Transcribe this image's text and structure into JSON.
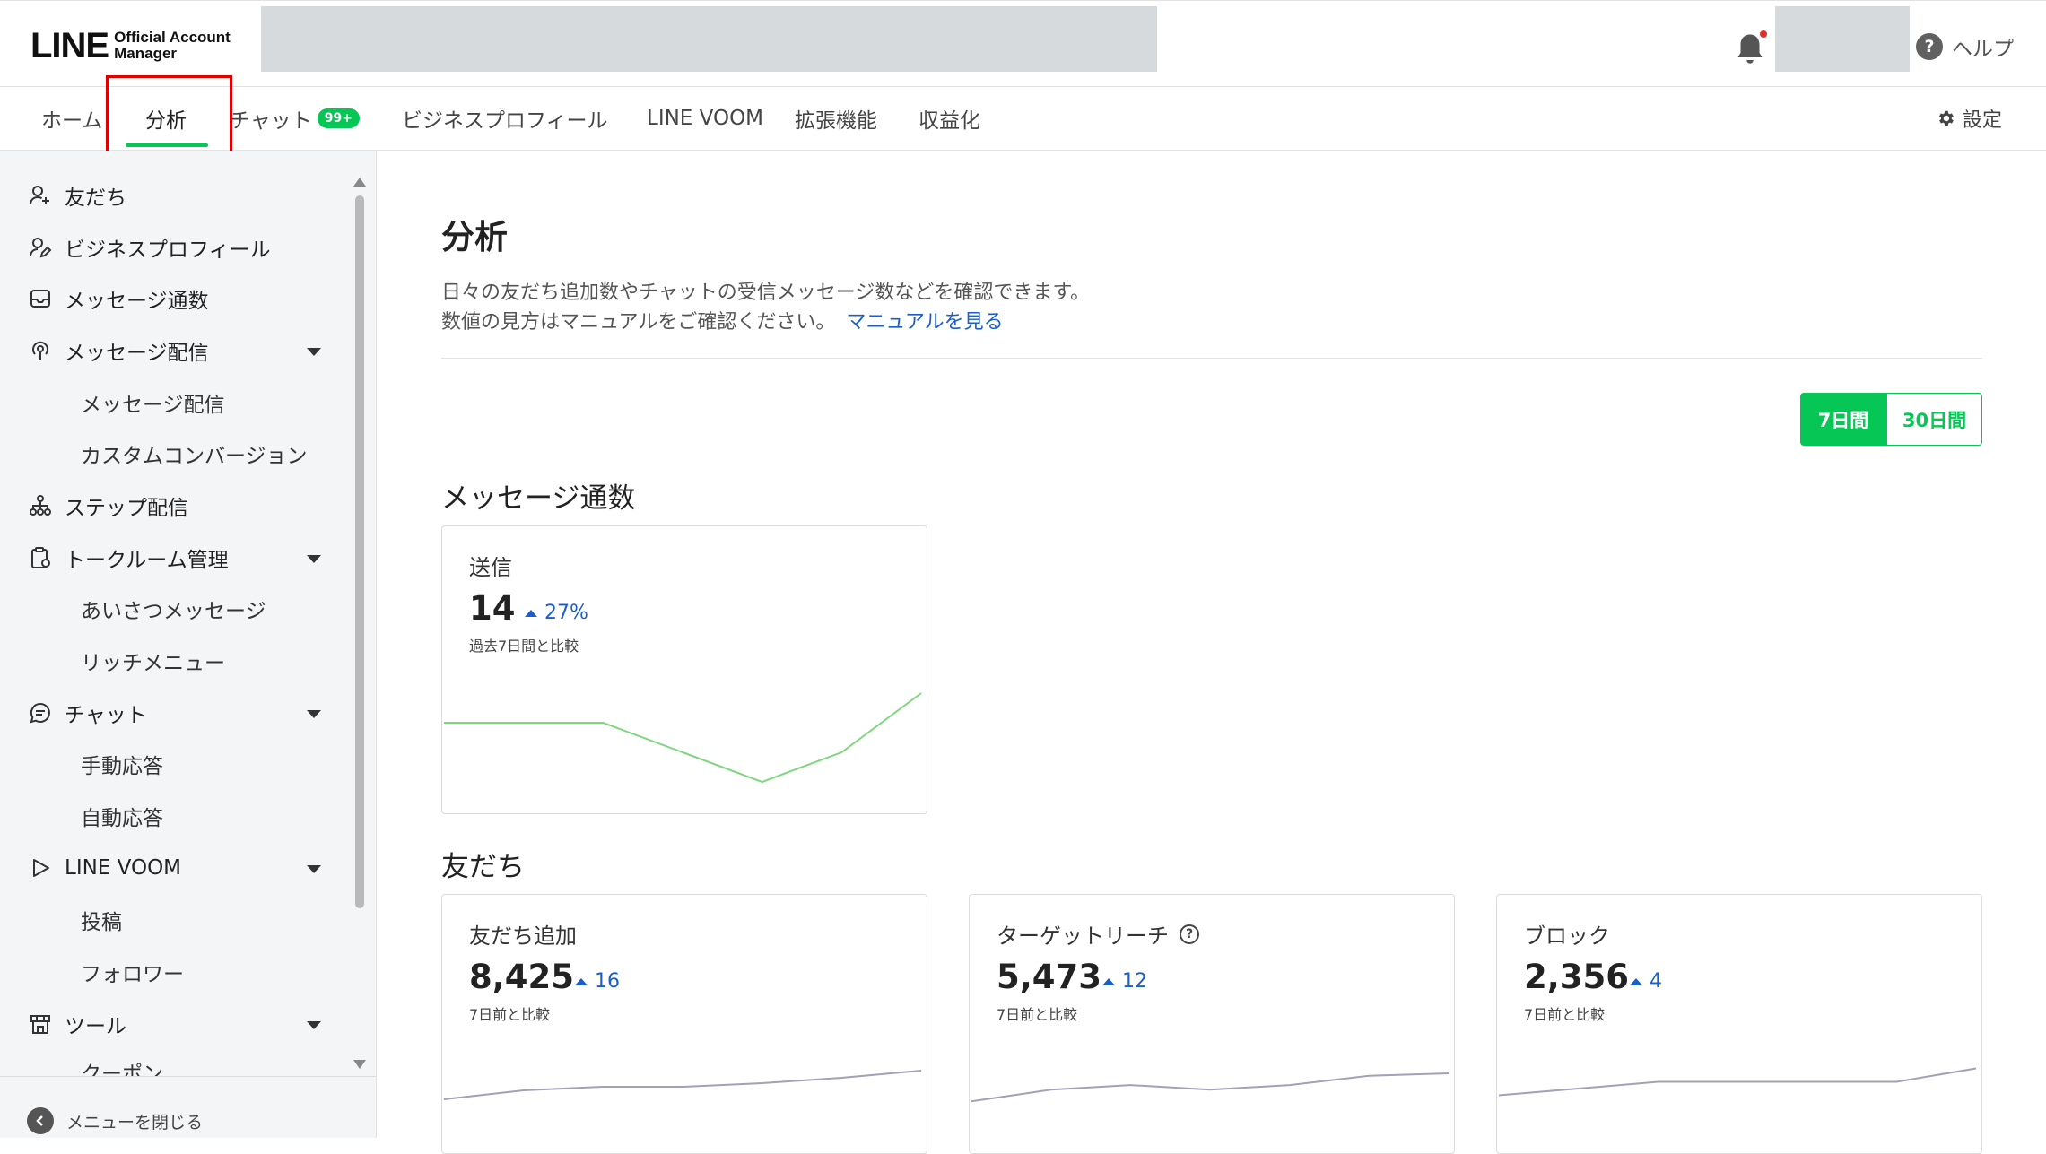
{
  "header": {
    "logo_main": "LINE",
    "logo_sub_line1": "Official Account",
    "logo_sub_line2": "Manager",
    "help_label": "ヘルプ"
  },
  "nav": {
    "tabs": [
      {
        "label": "ホーム"
      },
      {
        "label": "分析"
      },
      {
        "label": "チャット",
        "badge": "99+"
      },
      {
        "label": "ビジネスプロフィール"
      },
      {
        "label": "LINE VOOM"
      },
      {
        "label": "拡張機能"
      },
      {
        "label": "収益化"
      }
    ],
    "active_tab": "分析",
    "settings_label": "設定"
  },
  "sidebar": {
    "items": [
      {
        "label": "友だち",
        "icon": "user-add-icon"
      },
      {
        "label": "ビジネスプロフィール",
        "icon": "profile-edit-icon"
      },
      {
        "label": "メッセージ通数",
        "icon": "inbox-icon"
      },
      {
        "label": "メッセージ配信",
        "icon": "broadcast-icon",
        "expanded": true,
        "children": [
          "メッセージ配信",
          "カスタムコンバージョン"
        ]
      },
      {
        "label": "ステップ配信",
        "icon": "step-tree-icon"
      },
      {
        "label": "トークルーム管理",
        "icon": "clipboard-icon",
        "expanded": true,
        "children": [
          "あいさつメッセージ",
          "リッチメニュー"
        ]
      },
      {
        "label": "チャット",
        "icon": "chat-icon",
        "expanded": true,
        "children": [
          "手動応答",
          "自動応答"
        ]
      },
      {
        "label": "LINE VOOM",
        "icon": "play-icon",
        "expanded": true,
        "children": [
          "投稿",
          "フォロワー"
        ]
      },
      {
        "label": "ツール",
        "icon": "store-icon",
        "expanded": true,
        "children": [
          "クーポン"
        ]
      }
    ],
    "close_menu_label": "メニューを閉じる"
  },
  "main": {
    "title": "分析",
    "description_line1": "日々の友だち追加数やチャットの受信メッセージ数などを確認できます。",
    "description_line2": "数値の見方はマニュアルをご確認ください。",
    "manual_link": "マニュアルを見る",
    "period": {
      "options": [
        "7日間",
        "30日間"
      ],
      "selected": "7日間"
    },
    "sections": {
      "messages": {
        "title": "メッセージ通数",
        "cards": [
          {
            "label": "送信",
            "value": "14",
            "delta": "27%",
            "note": "過去7日間と比較",
            "trend": [
              3,
              3,
              3,
              2,
              1,
              2,
              4
            ]
          }
        ]
      },
      "friends": {
        "title": "友だち",
        "cards": [
          {
            "label": "友だち追加",
            "value": "8,425",
            "delta": "16",
            "note": "7日前と比較",
            "trend": [
              8409,
              8414,
              8416,
              8416,
              8418,
              8421,
              8425
            ]
          },
          {
            "label": "ターゲットリーチ",
            "value": "5,473",
            "delta": "12",
            "note": "7日前と比較",
            "has_help": true,
            "trend": [
              5461,
              5466,
              5468,
              5466,
              5468,
              5472,
              5473
            ]
          },
          {
            "label": "ブロック",
            "value": "2,356",
            "delta": "4",
            "note": "7日前と比較",
            "trend": [
              2352,
              2353,
              2354,
              2354,
              2354,
              2354,
              2356
            ]
          }
        ]
      }
    }
  },
  "colors": {
    "brand_green": "#06c755",
    "link_blue": "#1a5fc9",
    "spark_green": "#7ed67e",
    "spark_purple": "#a59fb8",
    "highlight_red": "#e00000"
  }
}
